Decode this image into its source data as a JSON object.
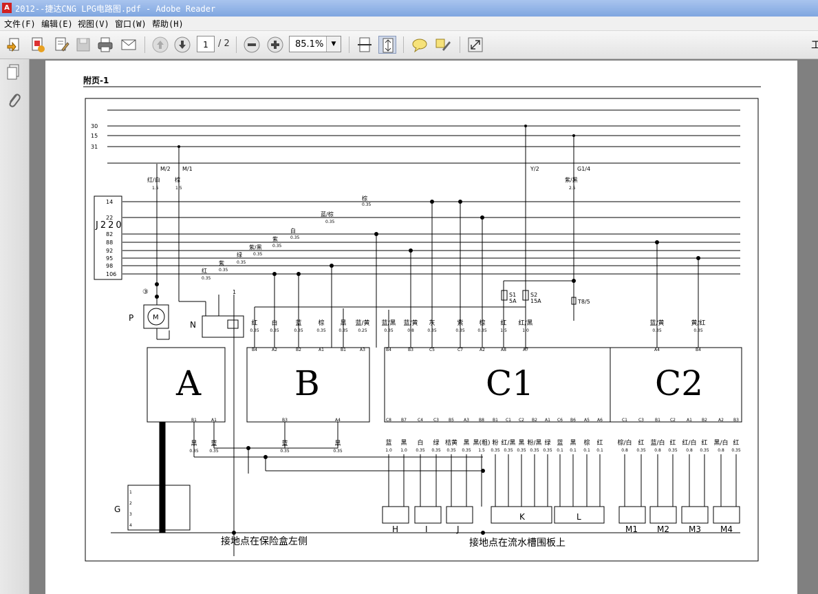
{
  "window": {
    "title": "2012--捷达CNG LPG电路图.pdf - Adobe Reader",
    "app_icon": "A"
  },
  "menu": [
    "文件(F)",
    "编辑(E)",
    "视图(V)",
    "窗口(W)",
    "帮助(H)"
  ],
  "toolbar": {
    "page_current": "1",
    "page_total": "/ 2",
    "zoom": "85.1%",
    "truncated_label": "工"
  },
  "page": {
    "header": "附页-1",
    "buses": [
      "30",
      "15",
      "31"
    ],
    "splice_labels": {
      "m2": "M/2",
      "m1": "M/1",
      "y2": "Y/2",
      "g14": "G1/4"
    },
    "top_wires": [
      {
        "color": "红/白",
        "gauge": "1.5"
      },
      {
        "color": "棕",
        "gauge": "1.5"
      },
      {
        "color": "紫/黑",
        "gauge": "2.5"
      }
    ],
    "j220": {
      "label": "J220",
      "pins": [
        "14",
        "22",
        "82",
        "88",
        "92",
        "95",
        "98",
        "106"
      ]
    },
    "j220_wires": [
      {
        "color": "棕",
        "gauge": "0.35"
      },
      {
        "color": "蓝/棕",
        "gauge": "0.35"
      },
      {
        "color": "白",
        "gauge": "0.35"
      },
      {
        "color": "紫",
        "gauge": "0.35"
      },
      {
        "color": "紫/黑",
        "gauge": "0.35"
      },
      {
        "color": "绿",
        "gauge": "0.35"
      },
      {
        "color": "紫",
        "gauge": "0.35"
      },
      {
        "color": "红",
        "gauge": "0.35"
      }
    ],
    "fuses": [
      {
        "name": "S1",
        "rating": "5A"
      },
      {
        "name": "S2",
        "rating": "15A"
      },
      {
        "name": "T8/5"
      }
    ],
    "marker_3": "③",
    "marker_1": "1",
    "components": {
      "A": "A",
      "B": "B",
      "C1": "C1",
      "C2": "C2",
      "P": "P",
      "N": "N",
      "G": "G",
      "M": "M",
      "H": "H",
      "I": "I",
      "J": "J",
      "K": "K",
      "L": "L",
      "M1": "M1",
      "M2": "M2",
      "M3": "M3",
      "M4": "M4"
    },
    "upper_wires": [
      {
        "color": "红",
        "gauge": "0.35"
      },
      {
        "color": "白",
        "gauge": "0.35"
      },
      {
        "color": "蓝",
        "gauge": "0.35"
      },
      {
        "color": "棕",
        "gauge": "0.35"
      },
      {
        "color": "黑",
        "gauge": "0.35"
      },
      {
        "color": "蓝/黄",
        "gauge": "0.25"
      },
      {
        "color": "蓝/黑",
        "gauge": "0.35"
      },
      {
        "color": "蓝/黄",
        "gauge": "0.8"
      },
      {
        "color": "灰",
        "gauge": "0.35"
      },
      {
        "color": "紫",
        "gauge": "0.35"
      },
      {
        "color": "棕",
        "gauge": "0.35"
      },
      {
        "color": "红",
        "gauge": "1.5"
      },
      {
        "color": "红/黑",
        "gauge": "1.0"
      },
      {
        "color": "蓝/黄",
        "gauge": "0.35"
      },
      {
        "color": "黄/红",
        "gauge": "0.35"
      }
    ],
    "upper_pins": [
      "B4",
      "A2",
      "B2",
      "A1",
      "B1",
      "A3",
      "B4",
      "B3",
      "C5",
      "C7",
      "A2",
      "A8",
      "A7",
      "A4",
      "B4"
    ],
    "lower_pins": [
      "B1",
      "A1",
      "B3",
      "A4",
      "C8",
      "B7",
      "C4",
      "C3",
      "B5",
      "A3",
      "B8",
      "B1",
      "C1",
      "C2",
      "B2",
      "A1",
      "C6",
      "B6",
      "A5",
      "A6",
      "C1",
      "C3",
      "B1",
      "C2",
      "A1",
      "B2",
      "A2",
      "B3"
    ],
    "lower_wires": [
      {
        "color": "黑",
        "gauge": "0.35"
      },
      {
        "color": "蓝",
        "gauge": "0.35"
      },
      {
        "color": "蓝",
        "gauge": "0.35"
      },
      {
        "color": "黑",
        "gauge": "0.35"
      },
      {
        "color": "蓝",
        "gauge": "1.0"
      },
      {
        "color": "黑",
        "gauge": "1.0"
      },
      {
        "color": "白",
        "gauge": "0.35"
      },
      {
        "color": "绿",
        "gauge": "0.35"
      },
      {
        "color": "桔黄",
        "gauge": "0.35"
      },
      {
        "color": "黑",
        "gauge": "0.35"
      },
      {
        "color": "黑(粗)",
        "gauge": "1.5"
      },
      {
        "color": "粉",
        "gauge": "0.35"
      },
      {
        "color": "红/黑",
        "gauge": "0.35"
      },
      {
        "color": "黑",
        "gauge": "0.35"
      },
      {
        "color": "粉/黑",
        "gauge": "0.35"
      },
      {
        "color": "绿",
        "gauge": "0.35"
      },
      {
        "color": "蓝",
        "gauge": "0.1"
      },
      {
        "color": "黑",
        "gauge": "0.1"
      },
      {
        "color": "棕",
        "gauge": "0.1"
      },
      {
        "color": "红",
        "gauge": "0.1"
      },
      {
        "color": "棕/白",
        "gauge": "0.8"
      },
      {
        "color": "红",
        "gauge": "0.35"
      },
      {
        "color": "蓝/白",
        "gauge": "0.8"
      },
      {
        "color": "红",
        "gauge": "0.35"
      },
      {
        "color": "红/白",
        "gauge": "0.8"
      },
      {
        "color": "红",
        "gauge": "0.35"
      },
      {
        "color": "黑/白",
        "gauge": "0.8"
      },
      {
        "color": "红",
        "gauge": "0.35"
      }
    ],
    "g_pins": [
      "1",
      "2",
      "3",
      "4"
    ],
    "ground_left": "接地点在保险盒左侧",
    "ground_right": "接地点在流水槽围板上"
  }
}
